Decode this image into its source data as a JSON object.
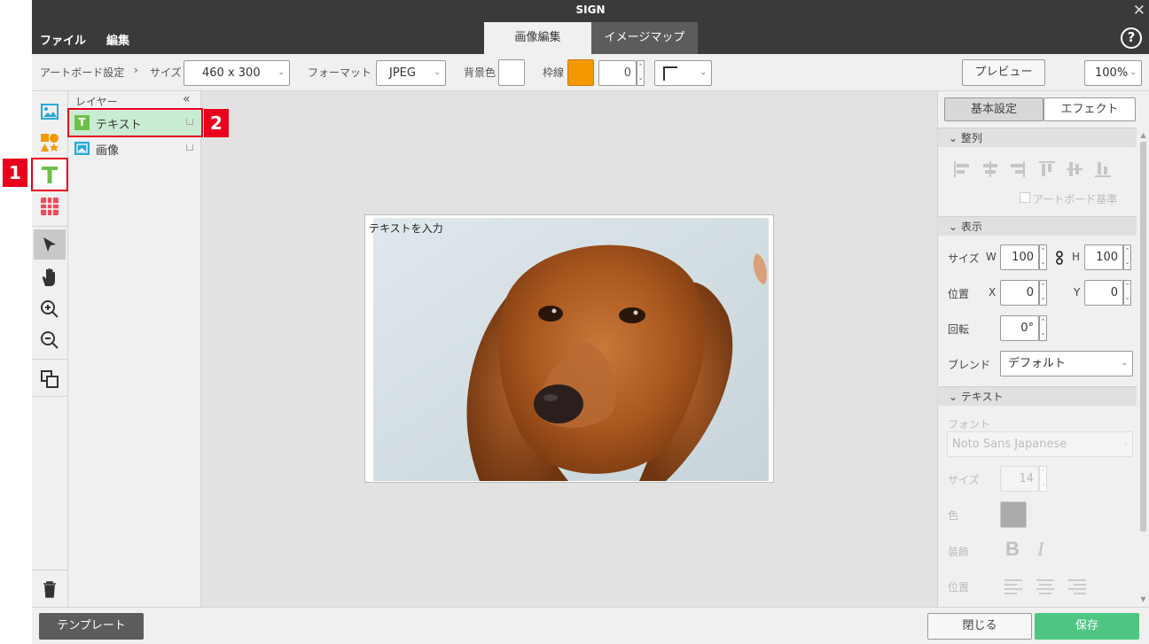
{
  "window": {
    "title": "SIGN",
    "close_glyph": "✕"
  },
  "menu": {
    "file": "ファイル",
    "edit": "編集",
    "help_glyph": "?"
  },
  "tabs": [
    {
      "label": "画像編集"
    },
    {
      "label": "イメージマップ"
    }
  ],
  "toolbar": {
    "artboard_label": "アートボード設定",
    "arrow": "›",
    "size_label": "サイズ",
    "size_value": "460 x 300",
    "format_label": "フォーマット",
    "format_value": "JPEG",
    "bg_label": "背景色",
    "border_label": "枠線",
    "border_width": "0",
    "preview": "プレビュー",
    "zoom": "100%",
    "bg_color": "#ffffff",
    "border_color": "#f39800"
  },
  "layers": {
    "header": "レイヤー",
    "collapse_glyph": "«",
    "items": [
      {
        "label": "テキスト",
        "icon": "T"
      },
      {
        "label": "画像"
      }
    ]
  },
  "canvas": {
    "text_placeholder": "テキストを入力"
  },
  "right": {
    "tabs": [
      "基本設定",
      "エフェクト"
    ],
    "align_header": "整列",
    "artboard_ref": "アートボード基準",
    "display_header": "表示",
    "size_label": "サイズ",
    "w_label": "W",
    "w_value": "100",
    "h_label": "H",
    "h_value": "100",
    "pos_label": "位置",
    "x_label": "X",
    "x_value": "0",
    "y_label": "Y",
    "y_value": "0",
    "rotate_label": "回転",
    "rotate_value": "0°",
    "blend_label": "ブレンド",
    "blend_value": "デフォルト",
    "text_header": "テキスト",
    "font_label": "フォント",
    "font_value": "Noto Sans Japanese",
    "font_size_label": "サイズ",
    "font_size_value": "14",
    "color_label": "色",
    "decoration_label": "装飾",
    "bold_glyph": "B",
    "italic_glyph": "I",
    "position_label": "位置"
  },
  "bottom": {
    "template": "テンプレート",
    "close": "閉じる",
    "save": "保存"
  },
  "callouts": [
    "1",
    "2"
  ],
  "colors": {
    "accent_green": "#4fc582",
    "highlight": "#c8ecd2",
    "callout_red": "#e8001c",
    "dark": "#3a3a3a"
  }
}
